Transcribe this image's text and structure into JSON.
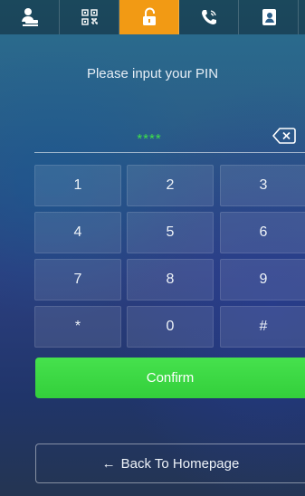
{
  "tabs": [
    {
      "icon": "person-desk-icon",
      "active": false
    },
    {
      "icon": "qr-code-icon",
      "active": false
    },
    {
      "icon": "unlock-icon",
      "active": true
    },
    {
      "icon": "phone-call-icon",
      "active": false
    },
    {
      "icon": "contacts-icon",
      "active": false
    }
  ],
  "pin_prompt": "Please input your PIN",
  "pin_value": "****",
  "keypad": {
    "k1": "1",
    "k2": "2",
    "k3": "3",
    "k4": "4",
    "k5": "5",
    "k6": "6",
    "k7": "7",
    "k8": "8",
    "k9": "9",
    "kstar": "*",
    "k0": "0",
    "khash": "#"
  },
  "confirm_label": "Confirm",
  "back_arrow": "←",
  "back_label": "Back To Homepage",
  "colors": {
    "accent_active_tab": "#f29a14",
    "confirm_green": "#3ad843",
    "pin_green": "#3ee04a"
  }
}
